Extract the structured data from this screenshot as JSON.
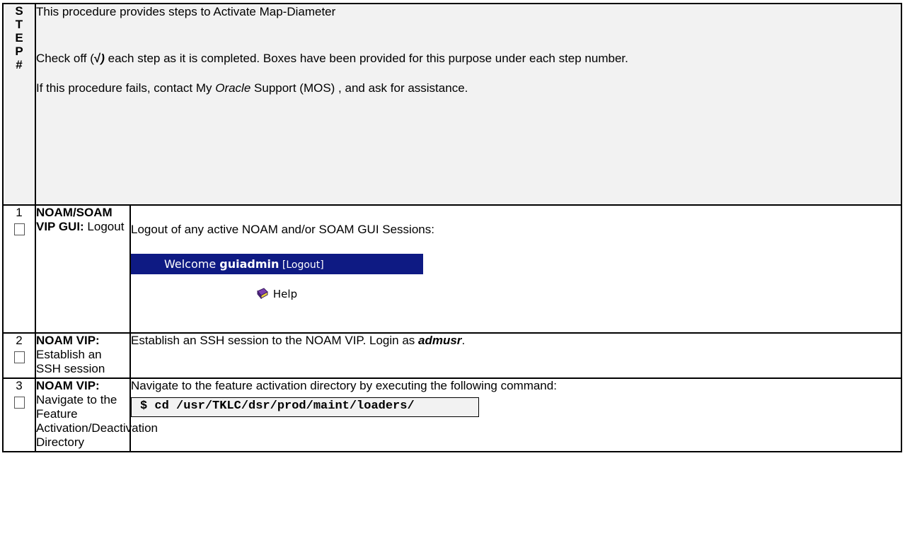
{
  "header": {
    "step_letters": [
      "S",
      "T",
      "E",
      "P",
      "#"
    ],
    "intro_line1": "This procedure provides steps to Activate Map-Diameter",
    "intro_line2_pre": "Check off (",
    "intro_check": "√",
    "intro_paren": ")",
    "intro_line2_post": " each step as it is completed. Boxes have been provided for this purpose under each step number.",
    "intro_line3_pre": "If this procedure fails, contact My ",
    "intro_line3_oracle": "Oracle",
    "intro_line3_post": " Support (MOS) , and ask for assistance."
  },
  "steps": [
    {
      "number": "1",
      "title_bold": "NOAM/SOAM VIP GUI:",
      "title_rest": " Logout",
      "desc": "Logout of any active NOAM and/or SOAM GUI Sessions:",
      "welcome_label": "Welcome ",
      "welcome_user": "guiadmin",
      "welcome_logout": " [Logout]",
      "help_label": "Help"
    },
    {
      "number": "2",
      "title_bold": "NOAM VIP:",
      "title_rest": " Establish an SSH session",
      "desc_pre": "Establish an SSH session to the NOAM VIP. Login as ",
      "desc_user": "admusr",
      "desc_post": "."
    },
    {
      "number": "3",
      "title_bold": "NOAM VIP:",
      "title_rest": " Navigate to the Feature Activation/Deactivation Directory",
      "desc": "Navigate to the feature activation directory by executing the following command:",
      "command": "$ cd /usr/TKLC/dsr/prod/maint/loaders/"
    }
  ],
  "colors": {
    "welcome_bar": "#0e1a83",
    "header_bg": "#f2f2f2"
  }
}
